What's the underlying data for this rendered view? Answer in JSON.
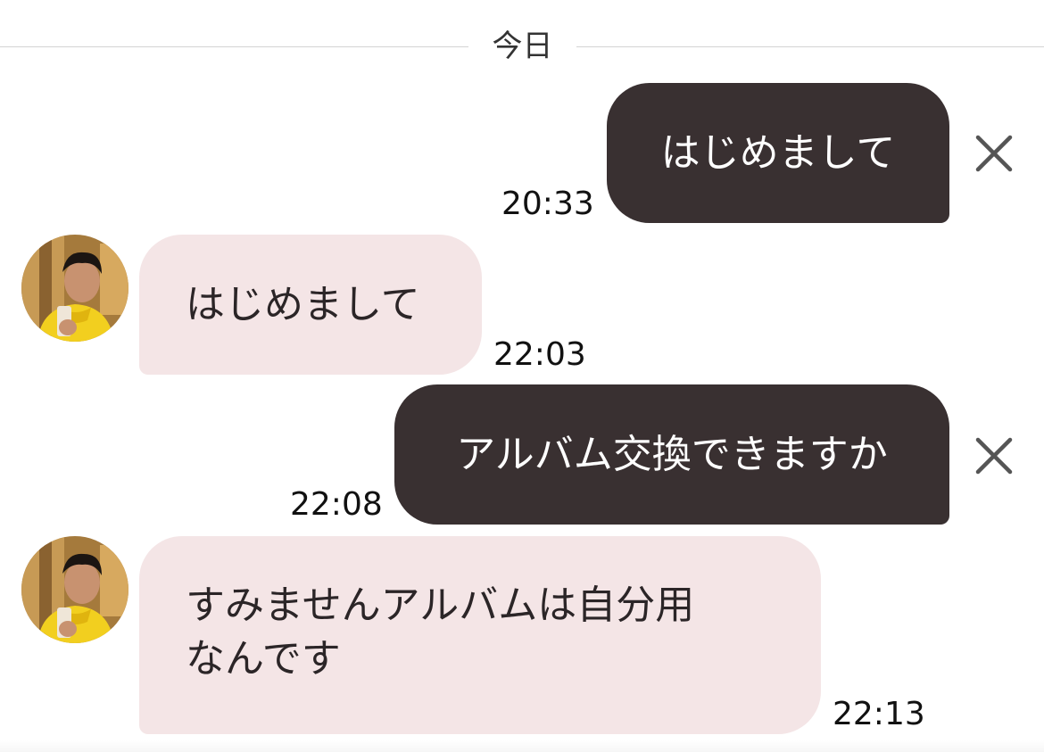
{
  "chat": {
    "date_label": "今日",
    "messages": [
      {
        "direction": "sent",
        "text": "はじめまして",
        "time": "20:33",
        "has_delete": true
      },
      {
        "direction": "received",
        "text": "はじめまして",
        "time": "22:03"
      },
      {
        "direction": "sent",
        "text": "アルバム交換できますか",
        "time": "22:08",
        "has_delete": true
      },
      {
        "direction": "received",
        "text_lines": [
          "すみませんアルバムは自分用",
          "なんです"
        ],
        "time": "22:13"
      }
    ]
  },
  "icons": {
    "delete": "close-x-icon",
    "avatar": "user-avatar-photo"
  },
  "colors": {
    "sent_bubble": "#393031",
    "received_bubble": "#f4e5e6",
    "divider": "#d4d4d4",
    "icon": "#555555"
  }
}
